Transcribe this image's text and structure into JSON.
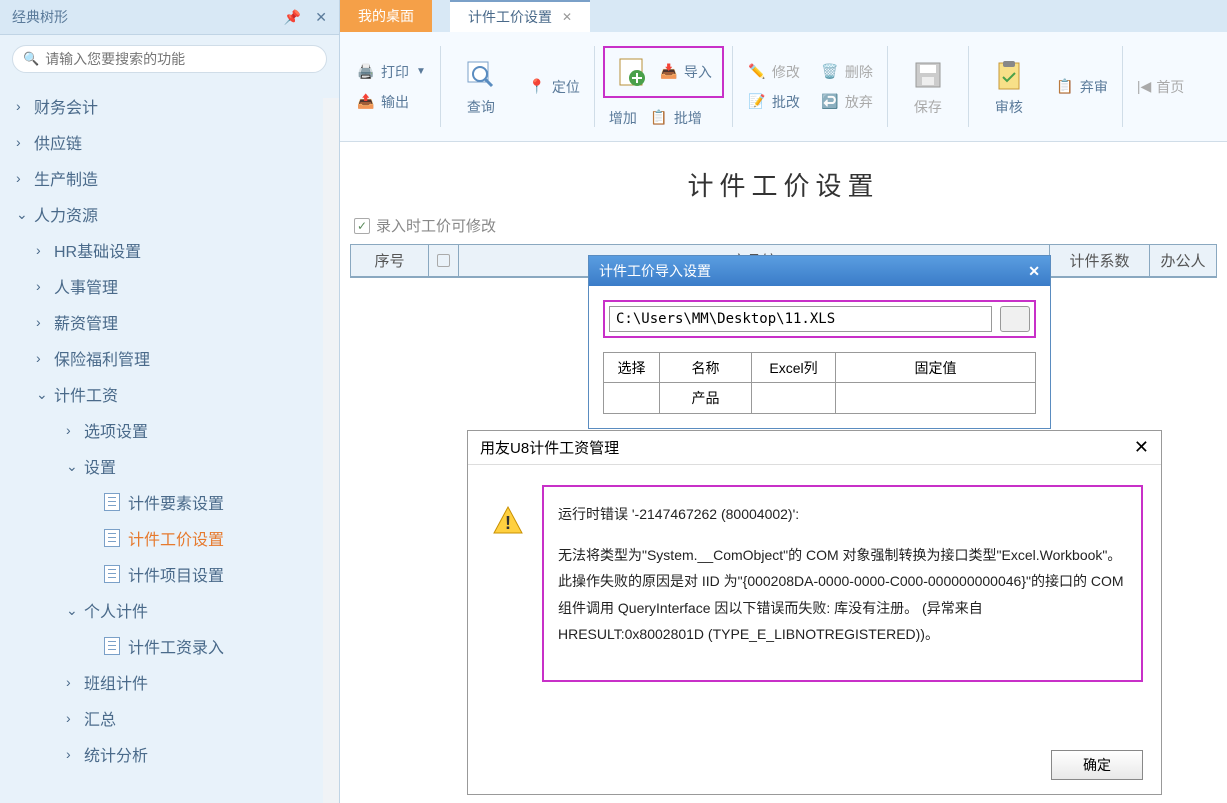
{
  "sidebar": {
    "title": "经典树形",
    "search_placeholder": "请输入您要搜索的功能",
    "items": [
      {
        "label": "财务会计",
        "lvl": 1,
        "chev": ">"
      },
      {
        "label": "供应链",
        "lvl": 1,
        "chev": ">"
      },
      {
        "label": "生产制造",
        "lvl": 1,
        "chev": ">"
      },
      {
        "label": "人力资源",
        "lvl": 1,
        "chev": "v"
      },
      {
        "label": "HR基础设置",
        "lvl": 2,
        "chev": ">"
      },
      {
        "label": "人事管理",
        "lvl": 2,
        "chev": ">"
      },
      {
        "label": "薪资管理",
        "lvl": 2,
        "chev": ">"
      },
      {
        "label": "保险福利管理",
        "lvl": 2,
        "chev": ">"
      },
      {
        "label": "计件工资",
        "lvl": 2,
        "chev": "v"
      },
      {
        "label": "选项设置",
        "lvl": 3,
        "chev": ">"
      },
      {
        "label": "设置",
        "lvl": 3,
        "chev": "v"
      },
      {
        "label": "计件要素设置",
        "lvl": 4,
        "doc": true
      },
      {
        "label": "计件工价设置",
        "lvl": 4,
        "doc": true,
        "active": true
      },
      {
        "label": "计件项目设置",
        "lvl": 4,
        "doc": true
      },
      {
        "label": "个人计件",
        "lvl": 3,
        "chev": "v"
      },
      {
        "label": "计件工资录入",
        "lvl": 4,
        "doc": true
      },
      {
        "label": "班组计件",
        "lvl": 3,
        "chev": ">"
      },
      {
        "label": "汇总",
        "lvl": 3,
        "chev": ">"
      },
      {
        "label": "统计分析",
        "lvl": 3,
        "chev": ">"
      }
    ]
  },
  "tabs": {
    "desktop": "我的桌面",
    "active": "计件工价设置"
  },
  "ribbon": {
    "print": "打印",
    "export": "输出",
    "query": "查询",
    "locate": "定位",
    "add": "增加",
    "import": "导入",
    "batch_add": "批增",
    "modify": "修改",
    "delete": "删除",
    "batch_mod": "批改",
    "discard": "放弃",
    "save": "保存",
    "audit": "审核",
    "abandon": "弃审",
    "first": "首页"
  },
  "page_title": "计件工价设置",
  "checkbox_label": "录入时工价可修改",
  "grid_headers": [
    "序号",
    "",
    "产品编",
    "计件系数",
    "办公人"
  ],
  "import_dialog": {
    "title": "计件工价导入设置",
    "path": "C:\\Users\\MM\\Desktop\\11.XLS",
    "cols": [
      "选择",
      "名称",
      "Excel列",
      "固定值"
    ],
    "row1_name": "产品"
  },
  "error_dialog": {
    "title": "用友U8计件工资管理",
    "line1": "运行时错误 '-2147467262 (80004002)':",
    "line2": "无法将类型为\"System.__ComObject\"的 COM 对象强制转换为接口类型\"Excel.Workbook\"。此操作失败的原因是对 IID 为\"{000208DA-0000-0000-C000-000000000046}\"的接口的 COM 组件调用 QueryInterface 因以下错误而失败: 库没有注册。 (异常来自 HRESULT:0x8002801D (TYPE_E_LIBNOTREGISTERED))。",
    "ok": "确定"
  }
}
